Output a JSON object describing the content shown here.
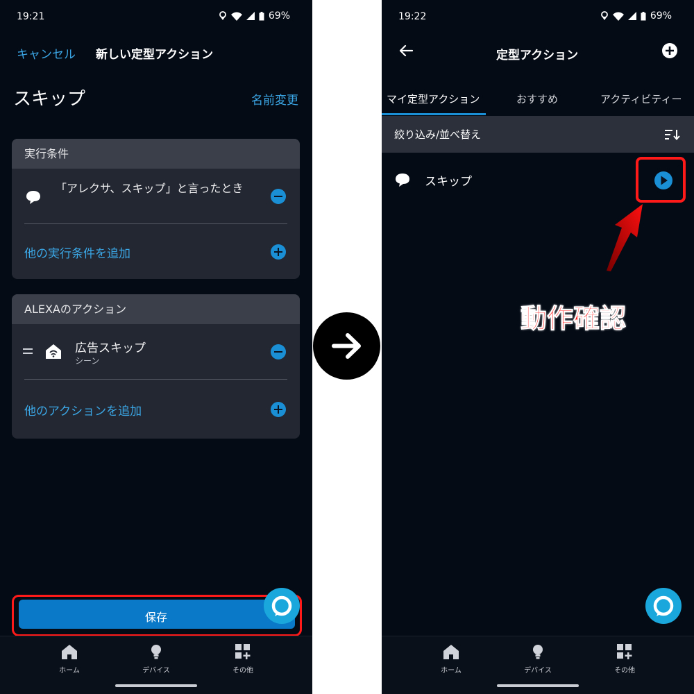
{
  "left": {
    "status": {
      "time": "19:21",
      "battery": "69%"
    },
    "header": {
      "cancel": "キャンセル",
      "title": "新しい定型アクション"
    },
    "name": {
      "title": "スキップ",
      "rename": "名前変更"
    },
    "conditions": {
      "header": "実行条件",
      "item": "「アレクサ、スキップ」と言ったとき",
      "add": "他の実行条件を追加"
    },
    "actions": {
      "header": "ALEXAのアクション",
      "item_title": "広告スキップ",
      "item_sub": "シーン",
      "add": "他のアクションを追加"
    },
    "save": "保存",
    "nav": {
      "home": "ホーム",
      "devices": "デバイス",
      "more": "その他"
    }
  },
  "right": {
    "status": {
      "time": "19:22",
      "battery": "69%"
    },
    "header": {
      "title": "定型アクション"
    },
    "tabs": [
      "マイ定型アクション",
      "おすすめ",
      "アクティビティー"
    ],
    "filter": "絞り込み/並べ替え",
    "routine": "スキップ",
    "annotation": "動作確認",
    "nav": {
      "home": "ホーム",
      "devices": "デバイス",
      "more": "その他"
    }
  },
  "colors": {
    "accent": "#3ba7e6",
    "highlight": "#ff0000",
    "background": "#050b15"
  },
  "icons": [
    "speech-bubble-icon",
    "home-scene-icon",
    "play-icon",
    "arrow-right-icon",
    "back-arrow-icon",
    "add-icon",
    "sort-icon",
    "alexa-icon"
  ]
}
